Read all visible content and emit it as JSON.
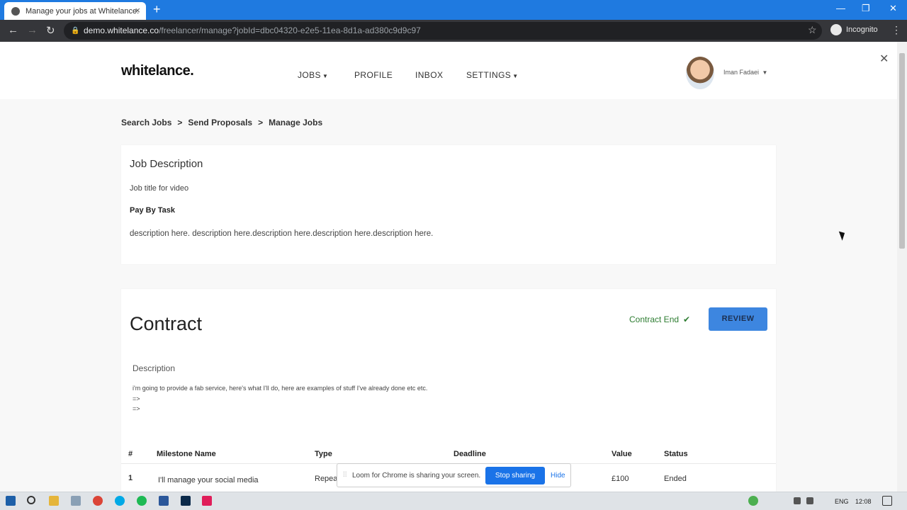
{
  "browser": {
    "tab_title": "Manage your jobs at Whitelance.",
    "url_host": "demo.whitelance.co",
    "url_path": "/freelancer/manage?jobId=dbc04320-e2e5-11ea-8d1a-ad380c9d9c97",
    "profile_label": "Incognito"
  },
  "header": {
    "logo": "whitelance.",
    "nav": [
      "JOBS",
      "PROFILE",
      "INBOX",
      "SETTINGS"
    ],
    "user_name": "Iman Fadaei"
  },
  "breadcrumb": [
    "Search Jobs",
    "Send Proposals",
    "Manage Jobs"
  ],
  "job": {
    "heading": "Job Description",
    "title": "Job title for video",
    "pay_type": "Pay By Task",
    "description": "description here. description here.description here.description here.description here."
  },
  "contract": {
    "heading": "Contract",
    "status_text": "Contract End",
    "review_label": "REVIEW",
    "description_label": "Description",
    "description_lines": [
      "i'm going to provide a fab service, here's what I'll do, here are examples of stuff I've already done etc etc.",
      "=>",
      "=>"
    ],
    "table_headers": [
      "#",
      "Milestone Name",
      "Type",
      "Deadline",
      "Value",
      "Status"
    ],
    "rows": [
      {
        "num": "1",
        "name": "I'll manage your social media",
        "type": "Repea",
        "deadline": "",
        "value": "£100",
        "status": "Ended"
      }
    ]
  },
  "loom": {
    "message": "Loom for Chrome is sharing your screen.",
    "stop_label": "Stop sharing",
    "hide_label": "Hide"
  },
  "taskbar": {
    "language": "ENG",
    "time": "12:08"
  }
}
